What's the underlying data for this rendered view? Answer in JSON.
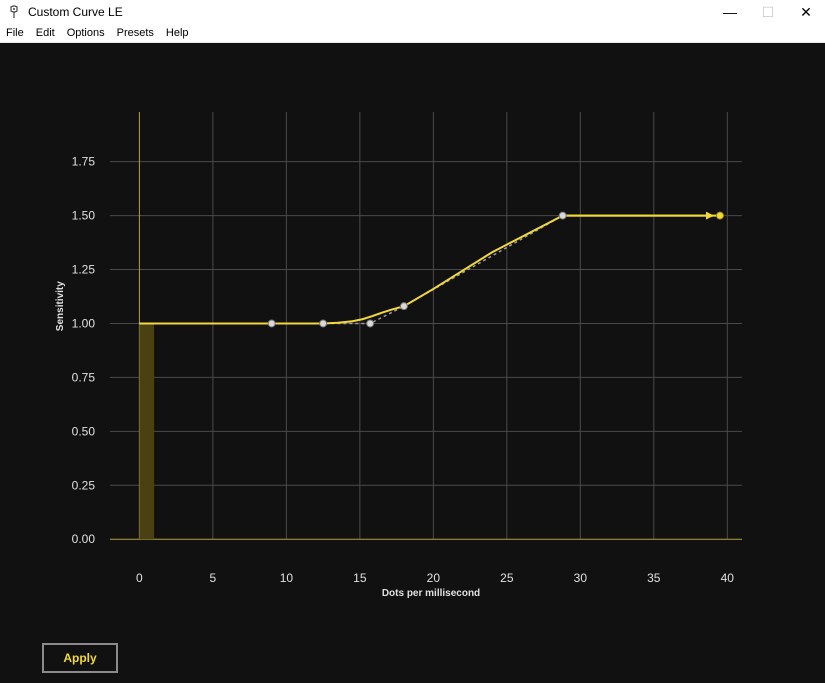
{
  "window": {
    "title": "Custom Curve LE",
    "icon": "app-icon",
    "controls": [
      "—",
      "☐",
      "✕"
    ]
  },
  "menu": {
    "items": [
      "File",
      "Edit",
      "Options",
      "Presets",
      "Help"
    ]
  },
  "colors": {
    "background": "#111111",
    "grid": "#4a4a4a",
    "axis": "#b5a33a",
    "curve": "#f2d83a",
    "points": "#d9d9d9",
    "velocity_bar": "#4a4112"
  },
  "chart_data": {
    "type": "line",
    "xlabel": "Dots per millisecond",
    "ylabel": "Sensitivity",
    "xlim": [
      -2,
      41
    ],
    "ylim": [
      -0.05,
      1.98
    ],
    "xticks": [
      0,
      5,
      10,
      15,
      20,
      25,
      30,
      35,
      40
    ],
    "yticks": [
      0.0,
      0.25,
      0.5,
      0.75,
      1.0,
      1.25,
      1.5,
      1.75
    ],
    "ytick_labels": [
      "0.00",
      "0.25",
      "0.50",
      "0.75",
      "1.00",
      "1.25",
      "1.50",
      "1.75"
    ],
    "grid": true,
    "curve": {
      "x": [
        0,
        9,
        12.5,
        13.5,
        14.5,
        15.2,
        15.8,
        16.5,
        17.2,
        18,
        20,
        24,
        28.8,
        39.5
      ],
      "y": [
        1.0,
        1.0,
        1.0,
        1.003,
        1.01,
        1.02,
        1.033,
        1.05,
        1.065,
        1.08,
        1.16,
        1.33,
        1.5,
        1.5
      ]
    },
    "control_line": {
      "x": [
        0,
        9,
        12.5,
        15.7,
        18,
        28.8
      ],
      "y": [
        1.0,
        1.0,
        1.0,
        1.0,
        1.08,
        1.5
      ]
    },
    "control_points": [
      {
        "x": 9,
        "y": 1.0
      },
      {
        "x": 12.5,
        "y": 1.0
      },
      {
        "x": 15.7,
        "y": 1.0
      },
      {
        "x": 18,
        "y": 1.08
      },
      {
        "x": 28.8,
        "y": 1.5
      }
    ],
    "endpoint": {
      "x": 39.5,
      "y": 1.5
    },
    "velocity_bar": {
      "x0": 0,
      "x1": 1.0,
      "y": 1.0
    }
  },
  "apply_button": {
    "label": "Apply"
  }
}
